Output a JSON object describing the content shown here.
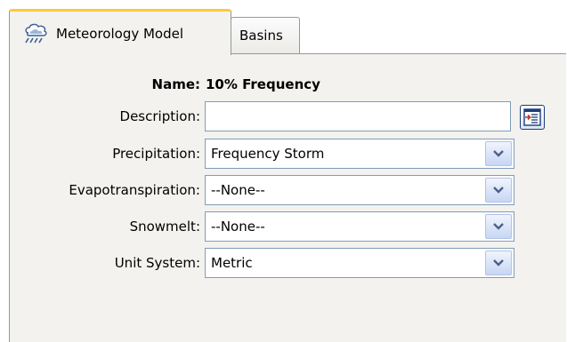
{
  "tabs": [
    {
      "label": "Meteorology Model",
      "icon": "weather-storm-icon",
      "active": true
    },
    {
      "label": "Basins",
      "active": false
    }
  ],
  "form": {
    "name_label": "Name:",
    "name_value": "10% Frequency",
    "description_label": "Description:",
    "description_value": "",
    "edit_button_icon": "description-editor-icon",
    "fields": [
      {
        "label": "Precipitation:",
        "value": "Frequency Storm"
      },
      {
        "label": "Evapotranspiration:",
        "value": "--None--"
      },
      {
        "label": "Snowmelt:",
        "value": "--None--"
      },
      {
        "label": "Unit System:",
        "value": "Metric"
      }
    ]
  },
  "colors": {
    "active_tab_accent": "#ffc83c",
    "panel_background": "#f3f2ef",
    "input_border": "#7f9db9",
    "arrow_color": "#4d6185"
  }
}
